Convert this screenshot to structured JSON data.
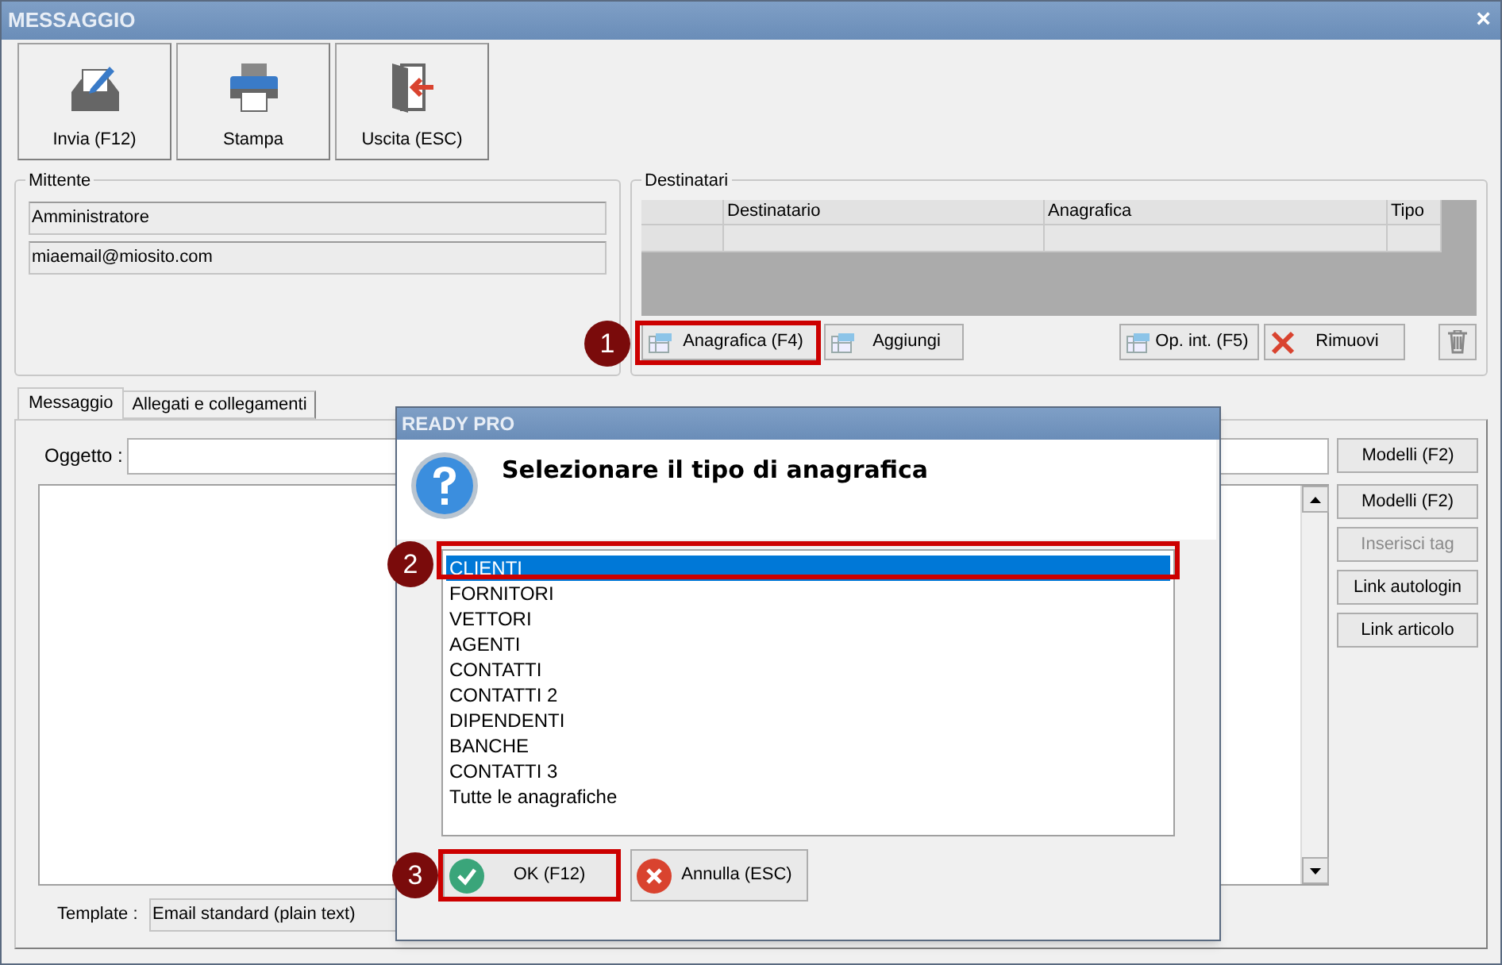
{
  "window": {
    "title": "MESSAGGIO",
    "close": "×"
  },
  "toolbar": [
    {
      "label": "Invia (F12)",
      "kind": "send"
    },
    {
      "label": "Stampa",
      "kind": "print"
    },
    {
      "label": "Uscita (ESC)",
      "kind": "exit"
    }
  ],
  "sender": {
    "title": "Mittente",
    "name": "Amministratore",
    "email": "miaemail@miosito.com"
  },
  "recipients": {
    "title": "Destinatari",
    "columns": [
      "Destinatario",
      "Anagrafica",
      "Tipo"
    ],
    "buttons": [
      {
        "label": "Anagrafica (F4)",
        "kind": "table"
      },
      {
        "label": "Aggiungi",
        "kind": "table"
      },
      {
        "label": "Op. int. (F5)",
        "kind": "table"
      },
      {
        "label": "Rimuovi",
        "kind": "remove"
      },
      {
        "kind": "trash"
      }
    ]
  },
  "tabs": [
    {
      "label": "Messaggio",
      "selected": true
    },
    {
      "label": "Allegati e collegamenti",
      "selected": false
    }
  ],
  "subject": {
    "label": "Oggetto :",
    "button": "Modelli (F2)"
  },
  "side_buttons": [
    {
      "label": "Modelli (F2)",
      "disabled": false
    },
    {
      "label": "Inserisci tag",
      "disabled": true
    },
    {
      "label": "Link autologin",
      "disabled": false
    },
    {
      "label": "Link articolo",
      "disabled": false
    }
  ],
  "template": {
    "label": "Template :",
    "value": "Email standard (plain text)"
  },
  "dialog": {
    "title": "READY PRO",
    "message": "Selezionare il tipo di anagrafica",
    "items": [
      {
        "label": "CLIENTI",
        "selected": true
      },
      {
        "label": "FORNITORI",
        "selected": false
      },
      {
        "label": "VETTORI",
        "selected": false
      },
      {
        "label": "AGENTI",
        "selected": false
      },
      {
        "label": "CONTATTI",
        "selected": false
      },
      {
        "label": "CONTATTI 2",
        "selected": false
      },
      {
        "label": "DIPENDENTI",
        "selected": false
      },
      {
        "label": "BANCHE",
        "selected": false
      },
      {
        "label": "CONTATTI 3",
        "selected": false
      },
      {
        "label": "Tutte le anagrafiche",
        "selected": false
      }
    ],
    "buttons": [
      {
        "label": "OK (F12)",
        "kind": "ok"
      },
      {
        "label": "Annulla (ESC)",
        "kind": "cancel"
      }
    ]
  },
  "callouts": [
    "1",
    "2",
    "3"
  ]
}
